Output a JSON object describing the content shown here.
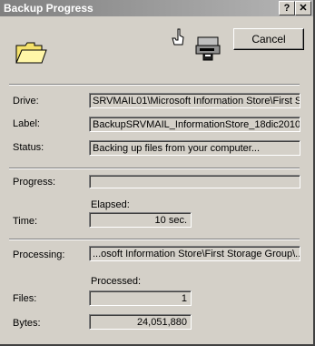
{
  "window": {
    "title": "Backup Progress",
    "help_glyph": "?",
    "close_glyph": "✕",
    "cancel_label": "Cancel"
  },
  "icons": {
    "folder": "folder-icon",
    "source": "hand-pointer-icon",
    "destination": "tape-drive-icon"
  },
  "info": {
    "drive_label": "Drive:",
    "drive_value": "SRVMAIL01\\Microsoft Information Store\\First St",
    "label_label": "Label:",
    "label_value": "BackupSRVMAIL_InformationStore_18dic2010.",
    "status_label": "Status:",
    "status_value": "Backing up files from your computer..."
  },
  "progress": {
    "progress_label": "Progress:",
    "progress_fraction": 0,
    "elapsed_label": "Elapsed:",
    "time_label": "Time:",
    "time_value": "10 sec."
  },
  "processing": {
    "processing_label": "Processing:",
    "processing_value": "...osoft Information Store\\First Storage Group\\...",
    "processed_label": "Processed:",
    "files_label": "Files:",
    "files_value": "1",
    "bytes_label": "Bytes:",
    "bytes_value": "24,051,880"
  },
  "colors": {
    "face": "#d4d0c8",
    "title_start": "#808080",
    "title_end": "#b6b6b6",
    "folder_yellow": "#f5e26b"
  }
}
